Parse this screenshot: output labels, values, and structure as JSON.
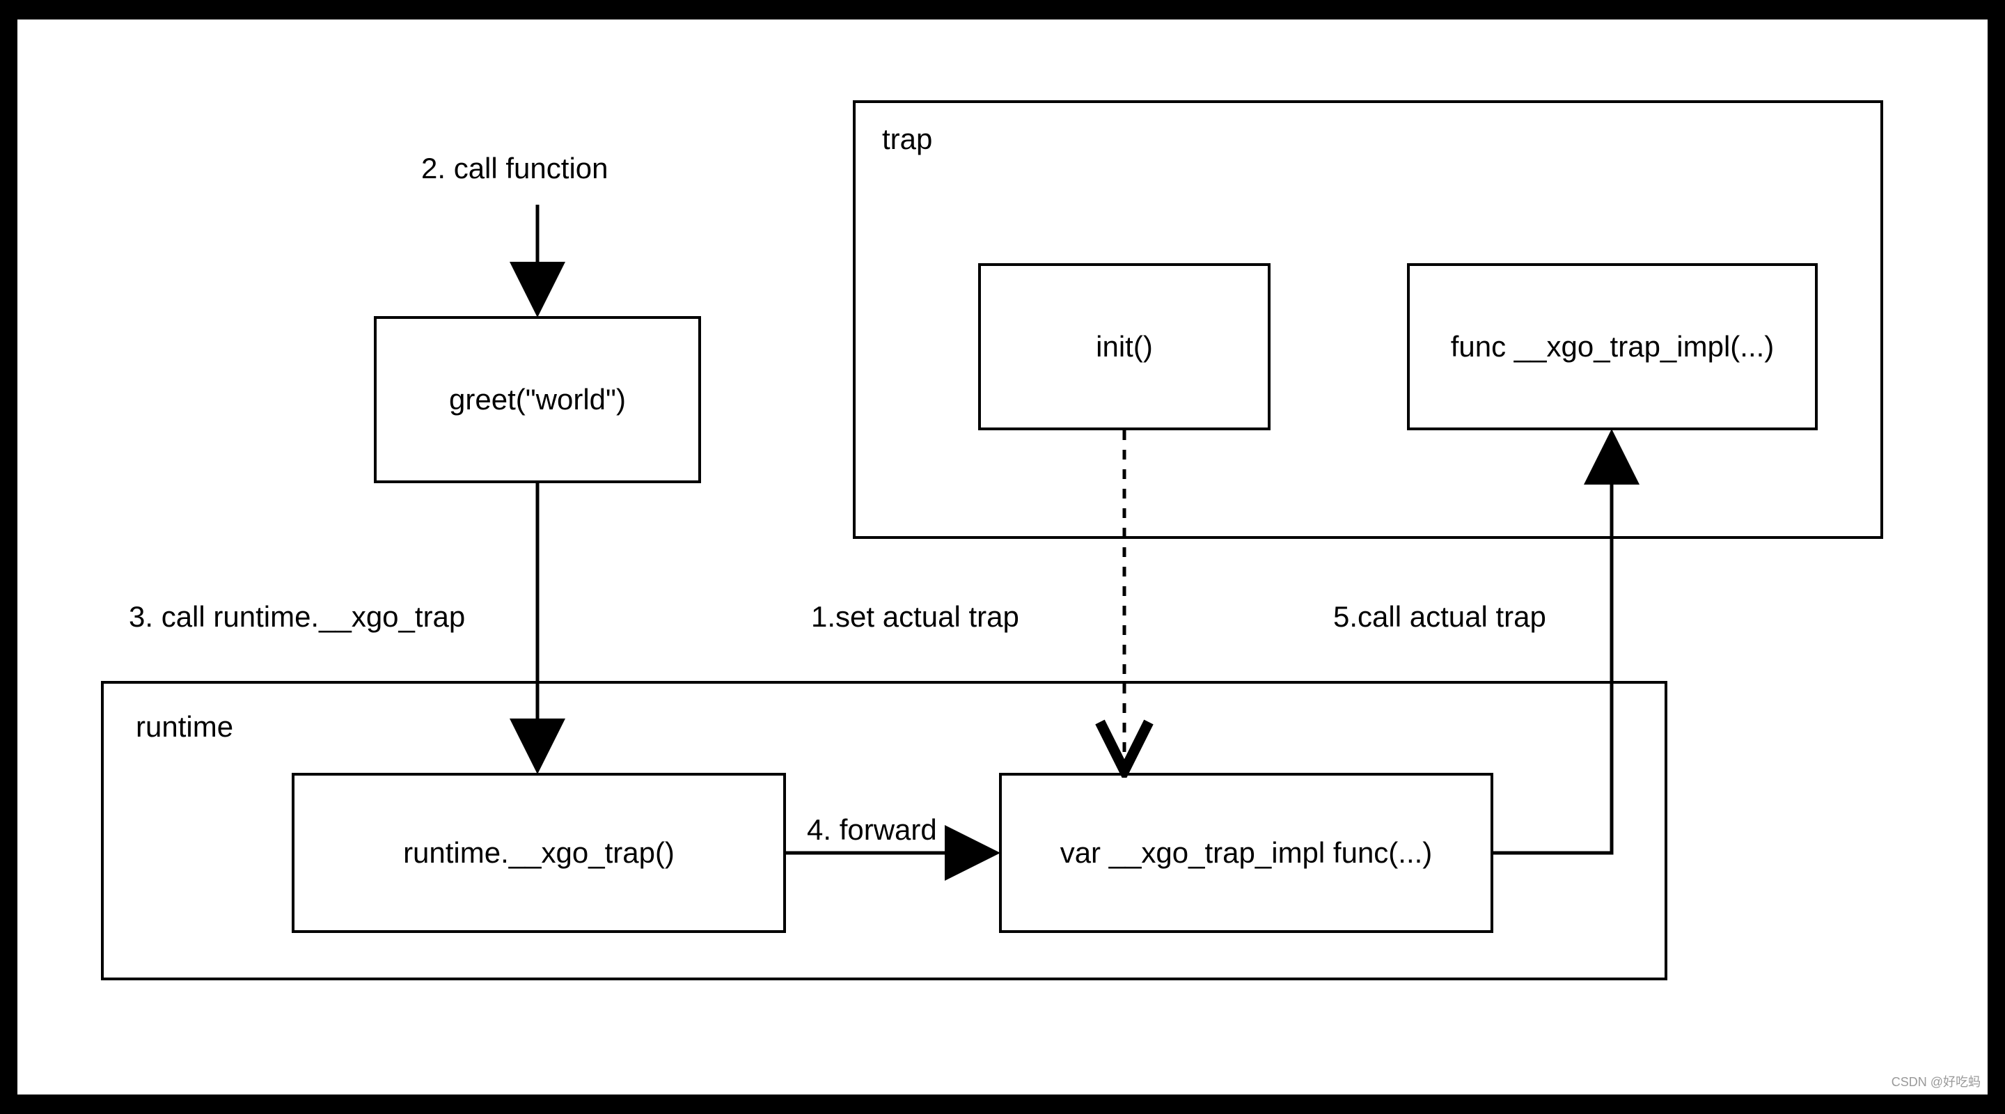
{
  "containers": {
    "trap": {
      "label": "trap"
    },
    "runtime": {
      "label": "runtime"
    }
  },
  "nodes": {
    "greet": {
      "text": "greet(\"world\")"
    },
    "init": {
      "text": "init()"
    },
    "trap_impl_func": {
      "text": "func __xgo_trap_impl(...)"
    },
    "runtime_trap": {
      "text": "runtime.__xgo_trap()"
    },
    "trap_impl_var": {
      "text": "var __xgo_trap_impl func(...)"
    }
  },
  "edges": {
    "set_actual_trap": {
      "label": "1.set actual trap"
    },
    "call_function": {
      "label": "2. call function"
    },
    "call_runtime_trap": {
      "label": "3. call runtime.__xgo_trap"
    },
    "forward": {
      "label": "4. forward"
    },
    "call_actual_trap": {
      "label": "5.call actual trap"
    }
  },
  "watermark": "CSDN @好吃蚂"
}
